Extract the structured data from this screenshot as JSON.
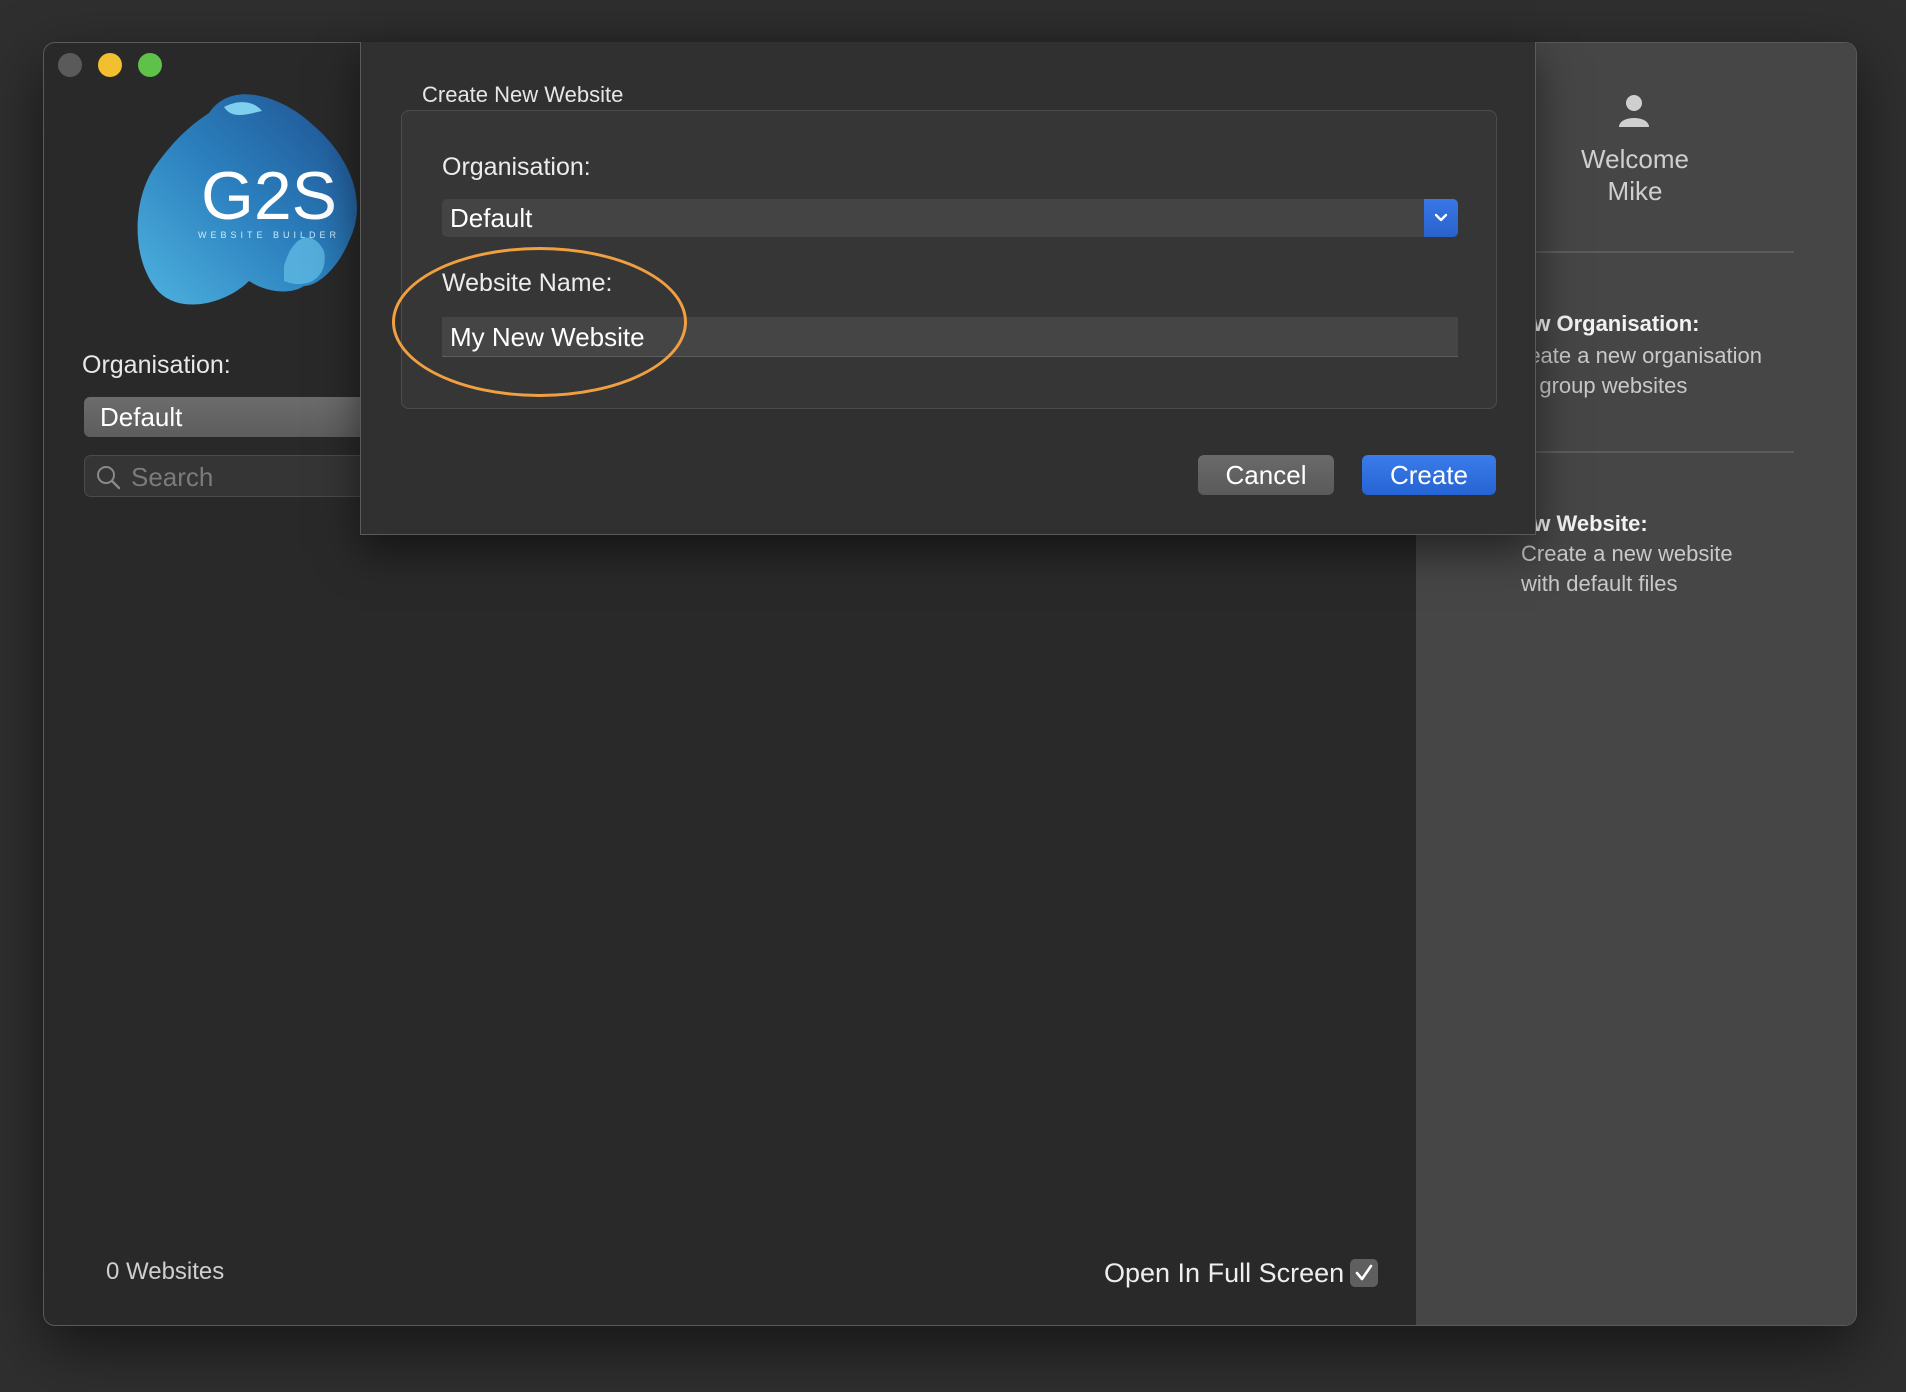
{
  "colors": {
    "accent": "#2f6fdc",
    "window_bg": "#292929",
    "sheet_bg": "#303030",
    "sidebar_bg": "#464646",
    "highlight": "#f0a040",
    "close_button": "#5a5a5a",
    "minimize_button": "#f2bf2f",
    "maximize_button": "#5fc14a"
  },
  "logo": {
    "wordmark": "G2S",
    "tagline": "WEBSITE BUILDER"
  },
  "sidebar": {
    "organisation_label": "Organisation:",
    "organisation_value": "Default",
    "search_placeholder": "Search",
    "search_icon": "search-icon",
    "websites_count": "0 Websites",
    "open_full_screen_label": "Open In Full Screen",
    "open_full_screen_checked": true
  },
  "dialog": {
    "title": "Create New Website",
    "organisation_label": "Organisation:",
    "organisation_value": "Default",
    "website_name_label": "Website Name:",
    "website_name_value": "My New Website",
    "cancel_label": "Cancel",
    "create_label": "Create"
  },
  "right_panel": {
    "user_icon": "user-icon",
    "welcome_line1": "Welcome",
    "welcome_line2": "Mike",
    "help_items": [
      {
        "title": "ew Organisation:",
        "line1": "reate a new organisation",
        "line2": "o group websites"
      },
      {
        "title": "ew Website:",
        "line1": "Create a new website",
        "line2": "with default files"
      }
    ]
  }
}
